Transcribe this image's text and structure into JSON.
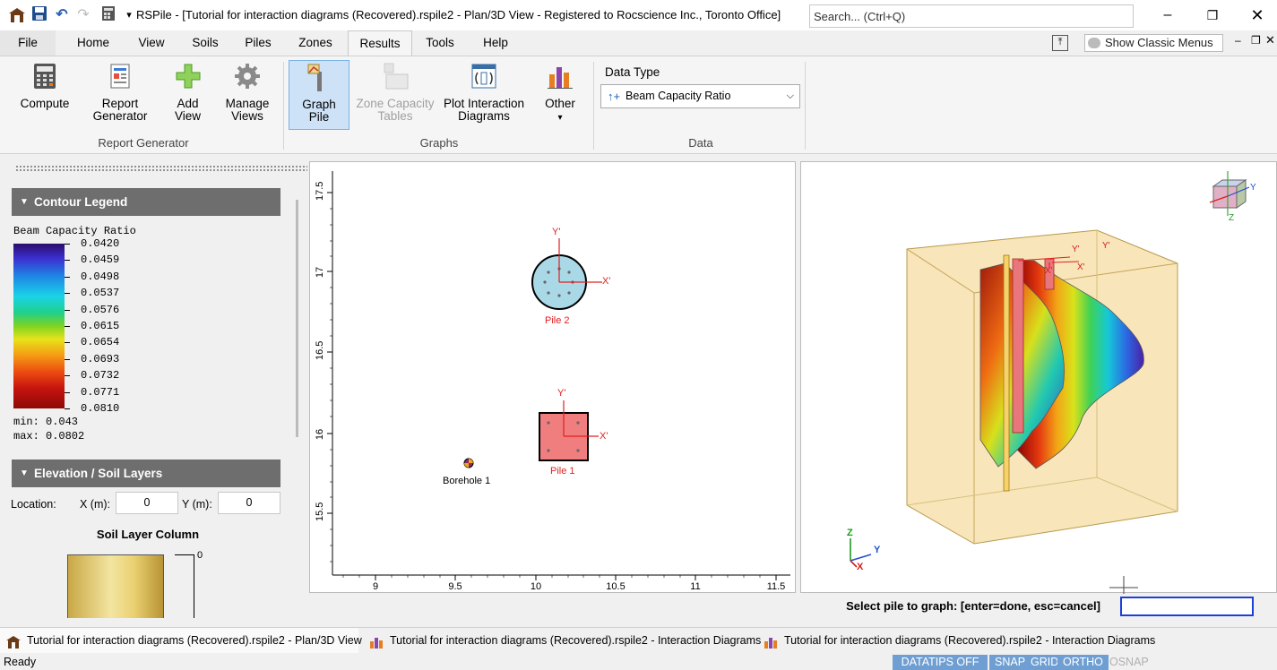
{
  "app": {
    "title": "RSPile - [Tutorial for interaction diagrams (Recovered).rspile2 - Plan/3D View - Registered to Rocscience Inc., Toronto Office]",
    "search_placeholder": "Search... (Ctrl+Q)"
  },
  "menu": {
    "tabs": [
      "File",
      "Home",
      "View",
      "Soils",
      "Piles",
      "Zones",
      "Results",
      "Tools",
      "Help"
    ],
    "active": "Results",
    "classic_menus_label": "Show Classic Menus"
  },
  "ribbon": {
    "buttons": {
      "compute": [
        "Compute"
      ],
      "report_generator": [
        "Report",
        "Generator"
      ],
      "add_view": [
        "Add",
        "View"
      ],
      "manage_views": [
        "Manage",
        "Views"
      ],
      "graph_pile": [
        "Graph",
        "Pile"
      ],
      "zone_capacity_tables": [
        "Zone Capacity",
        "Tables"
      ],
      "plot_interaction_diagrams": [
        "Plot Interaction",
        "Diagrams"
      ],
      "other": [
        "Other"
      ]
    },
    "groups": {
      "report_generator": "Report Generator",
      "graphs": "Graphs",
      "data": "Data"
    },
    "data_type_label": "Data Type",
    "data_type_value": "Beam Capacity Ratio"
  },
  "left_panel": {
    "contour_legend": {
      "header": "Contour Legend",
      "title": "Beam Capacity Ratio",
      "ticks": [
        "0.0420",
        "0.0459",
        "0.0498",
        "0.0537",
        "0.0576",
        "0.0615",
        "0.0654",
        "0.0693",
        "0.0732",
        "0.0771",
        "0.0810"
      ],
      "min_label": "min: 0.043",
      "max_label": "max: 0.0802"
    },
    "elevation": {
      "header": "Elevation / Soil Layers",
      "location_label": "Location:",
      "x_label": "X (m):",
      "x_value": "0",
      "y_label": "Y (m):",
      "y_value": "0",
      "column_title": "Soil Layer Column",
      "column_top_tick": "0"
    }
  },
  "plan_view": {
    "y_ticks": [
      "17.5",
      "17",
      "16.5",
      "16",
      "15.5"
    ],
    "x_ticks": [
      "9",
      "9.5",
      "10",
      "10.5",
      "11",
      "11.5"
    ],
    "pile2": {
      "label": "Pile 2",
      "x_axis": "X'",
      "y_axis": "Y'"
    },
    "pile1": {
      "label": "Pile 1",
      "x_axis": "X'",
      "y_axis": "Y'"
    },
    "borehole": {
      "label": "Borehole 1"
    }
  },
  "view3d": {
    "axis_labels": {
      "x": "X",
      "y": "Y",
      "z": "Z"
    },
    "pile_axis_labels": {
      "x": "X'",
      "y": "Y'"
    }
  },
  "prompt": {
    "text": "Select pile to graph: [enter=done, esc=cancel]"
  },
  "doc_tabs": [
    "Tutorial for interaction diagrams (Recovered).rspile2 - Plan/3D View",
    "Tutorial for interaction diagrams (Recovered).rspile2 - Interaction Diagrams",
    "Tutorial for interaction diagrams (Recovered).rspile2 - Interaction Diagrams"
  ],
  "status": {
    "ready": "Ready",
    "datatips": "DATATIPS OFF",
    "snap": "SNAP",
    "grid": "GRID",
    "ortho": "ORTHO",
    "osnap": "OSNAP"
  }
}
